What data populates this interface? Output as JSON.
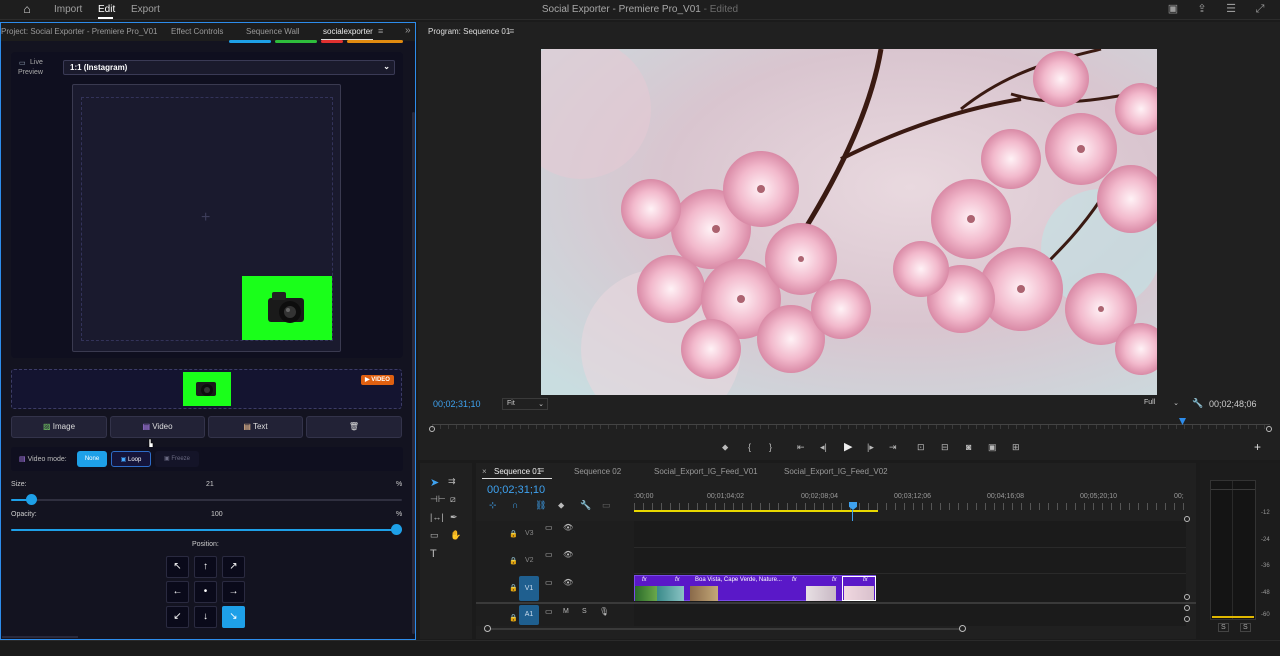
{
  "menu": {
    "import": "Import",
    "edit": "Edit",
    "export": "Export"
  },
  "app_title": "Social Exporter - Premiere Pro_V01",
  "title_status": "- Edited",
  "left_tabs": [
    "Project: Social Exporter - Premiere Pro_V01",
    "Effect Controls",
    "Sequence Wall",
    "socialexporter"
  ],
  "panel": {
    "live_label": "Live",
    "preview_label": "Preview",
    "format_select": "1:1 (Instagram)",
    "video_badge": "VIDEO",
    "buttons": {
      "image": "Image",
      "video": "Video",
      "text": "Text"
    },
    "video_mode_label": "Video mode:",
    "modes": [
      "None",
      "Loop",
      "Freeze"
    ],
    "active_mode": "None",
    "size_label": "Size:",
    "size_value": "21",
    "size_unit": "%",
    "size_level": 0.21,
    "opacity_label": "Opacity:",
    "opacity_value": "100",
    "opacity_unit": "%",
    "opacity_level": 1.0,
    "position_label": "Position:",
    "position_grid": [
      "↖",
      "↑",
      "↗",
      "←",
      "•",
      "→",
      "↙",
      "↓",
      "↘"
    ],
    "active_position": "↘"
  },
  "program": {
    "title": "Program: Sequence 01",
    "timecode_left": "00;02;31;10",
    "fit_label": "Fit",
    "full_label": "Full",
    "timecode_right": "00;02;48;06"
  },
  "timeline": {
    "tabs": [
      "Sequence 01",
      "Sequence 02",
      "Social_Export_IG_Feed_V01",
      "Social_Export_IG_Feed_V02"
    ],
    "timecode": "00;02;31;10",
    "ruler": [
      ":00;00",
      "00;01;04;02",
      "00;02;08;04",
      "00;03;12;06",
      "00;04;16;08",
      "00;05;20;10",
      "00;"
    ],
    "tracks": [
      "V3",
      "V2",
      "V1",
      "A1"
    ],
    "a1_buttons": [
      "M",
      "S"
    ],
    "clip_label": "Boa Vista, Cape Verde, Nature...",
    "fx": "fx"
  },
  "meter": {
    "ticks": [
      "-12",
      "-24",
      "-36",
      "-48",
      "-60"
    ],
    "solo": [
      "S",
      "S"
    ]
  },
  "colors": {
    "accent": "#1ea0e8",
    "clip": "#5a18c8",
    "green": "#1aff1a",
    "badge": "#e06010",
    "panel_border": "#2d8ceb"
  }
}
